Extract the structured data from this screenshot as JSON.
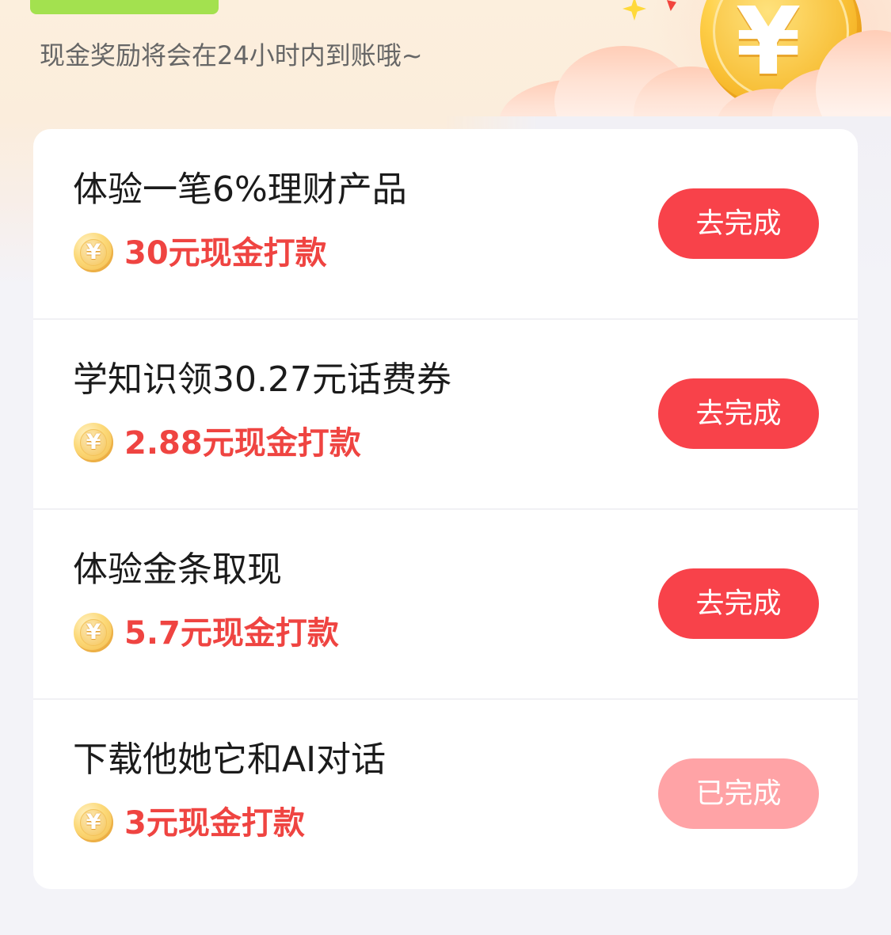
{
  "coin_symbol": "¥",
  "header": {
    "subtitle": "现金奖励将会在24小时内到账哦~"
  },
  "tasks": [
    {
      "title": "体验一笔6%理财产品",
      "reward": "30元现金打款",
      "button": "去完成",
      "completed": false
    },
    {
      "title": "学知识领30.27元话费券",
      "reward": "2.88元现金打款",
      "button": "去完成",
      "completed": false
    },
    {
      "title": "体验金条取现",
      "reward": "5.7元现金打款",
      "button": "去完成",
      "completed": false
    },
    {
      "title": "下载他她它和AI对话",
      "reward": "3元现金打款",
      "button": "已完成",
      "completed": true
    }
  ],
  "icons": {
    "header_coin": "gold-coin-icon",
    "reward_coin": "yuan-coin-icon",
    "sparkle": "sparkle-star-icon",
    "confetti": "confetti-icon"
  },
  "colors": {
    "button": "#f8424a",
    "button_completed": "#ffa3a6",
    "button_text": "#ffffff",
    "reward_text": "#ef4441",
    "title_text": "#1b1b1b",
    "subtitle_text": "#666666",
    "card_background": "#ffffff",
    "page_background": "#f3f3f8"
  }
}
